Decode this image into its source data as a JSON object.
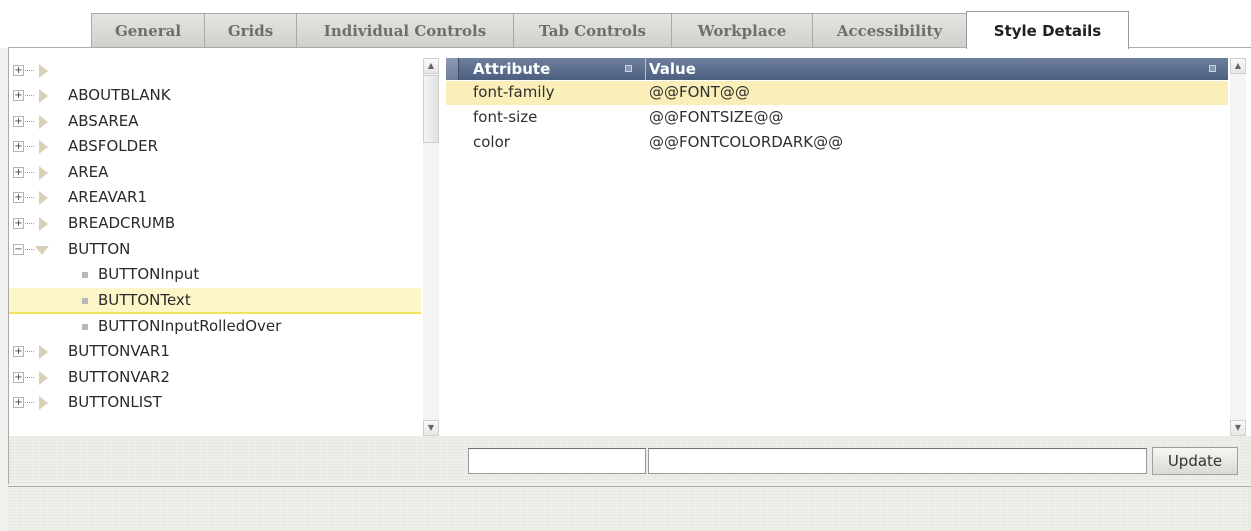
{
  "tabs": [
    {
      "label": "General",
      "active": false
    },
    {
      "label": "Grids",
      "active": false
    },
    {
      "label": "Individual Controls",
      "active": false
    },
    {
      "label": "Tab Controls",
      "active": false
    },
    {
      "label": "Workplace",
      "active": false
    },
    {
      "label": "Accessibility",
      "active": false
    },
    {
      "label": "Style Details",
      "active": true
    }
  ],
  "tree": {
    "nodes": [
      {
        "label": "",
        "state": "collapsed",
        "level": 0
      },
      {
        "label": "ABOUTBLANK",
        "state": "collapsed",
        "level": 0
      },
      {
        "label": "ABSAREA",
        "state": "collapsed",
        "level": 0
      },
      {
        "label": "ABSFOLDER",
        "state": "collapsed",
        "level": 0
      },
      {
        "label": "AREA",
        "state": "collapsed",
        "level": 0
      },
      {
        "label": "AREAVAR1",
        "state": "collapsed",
        "level": 0
      },
      {
        "label": "BREADCRUMB",
        "state": "collapsed",
        "level": 0
      },
      {
        "label": "BUTTON",
        "state": "expanded",
        "level": 0
      },
      {
        "label": "BUTTONInput",
        "state": "leaf",
        "level": 1
      },
      {
        "label": "BUTTONText",
        "state": "leaf",
        "level": 1,
        "selected": true
      },
      {
        "label": "BUTTONInputRolledOver",
        "state": "leaf",
        "level": 1
      },
      {
        "label": "BUTTONVAR1",
        "state": "collapsed",
        "level": 0
      },
      {
        "label": "BUTTONVAR2",
        "state": "collapsed",
        "level": 0
      },
      {
        "label": "BUTTONLIST",
        "state": "collapsed",
        "level": 0
      }
    ]
  },
  "grid": {
    "columns": [
      "Attribute",
      "Value"
    ],
    "rows": [
      {
        "attribute": "font-family",
        "value": "@@FONT@@",
        "selected": true
      },
      {
        "attribute": "font-size",
        "value": "@@FONTSIZE@@",
        "selected": false
      },
      {
        "attribute": "color",
        "value": "@@FONTCOLORDARK@@",
        "selected": false
      }
    ]
  },
  "editor": {
    "attribute_value": "",
    "value_value": "",
    "update_label": "Update"
  },
  "colors": {
    "grid_header": "#566a8a",
    "selection": "#fbefb9",
    "tree_selection": "#fdf6c8"
  }
}
